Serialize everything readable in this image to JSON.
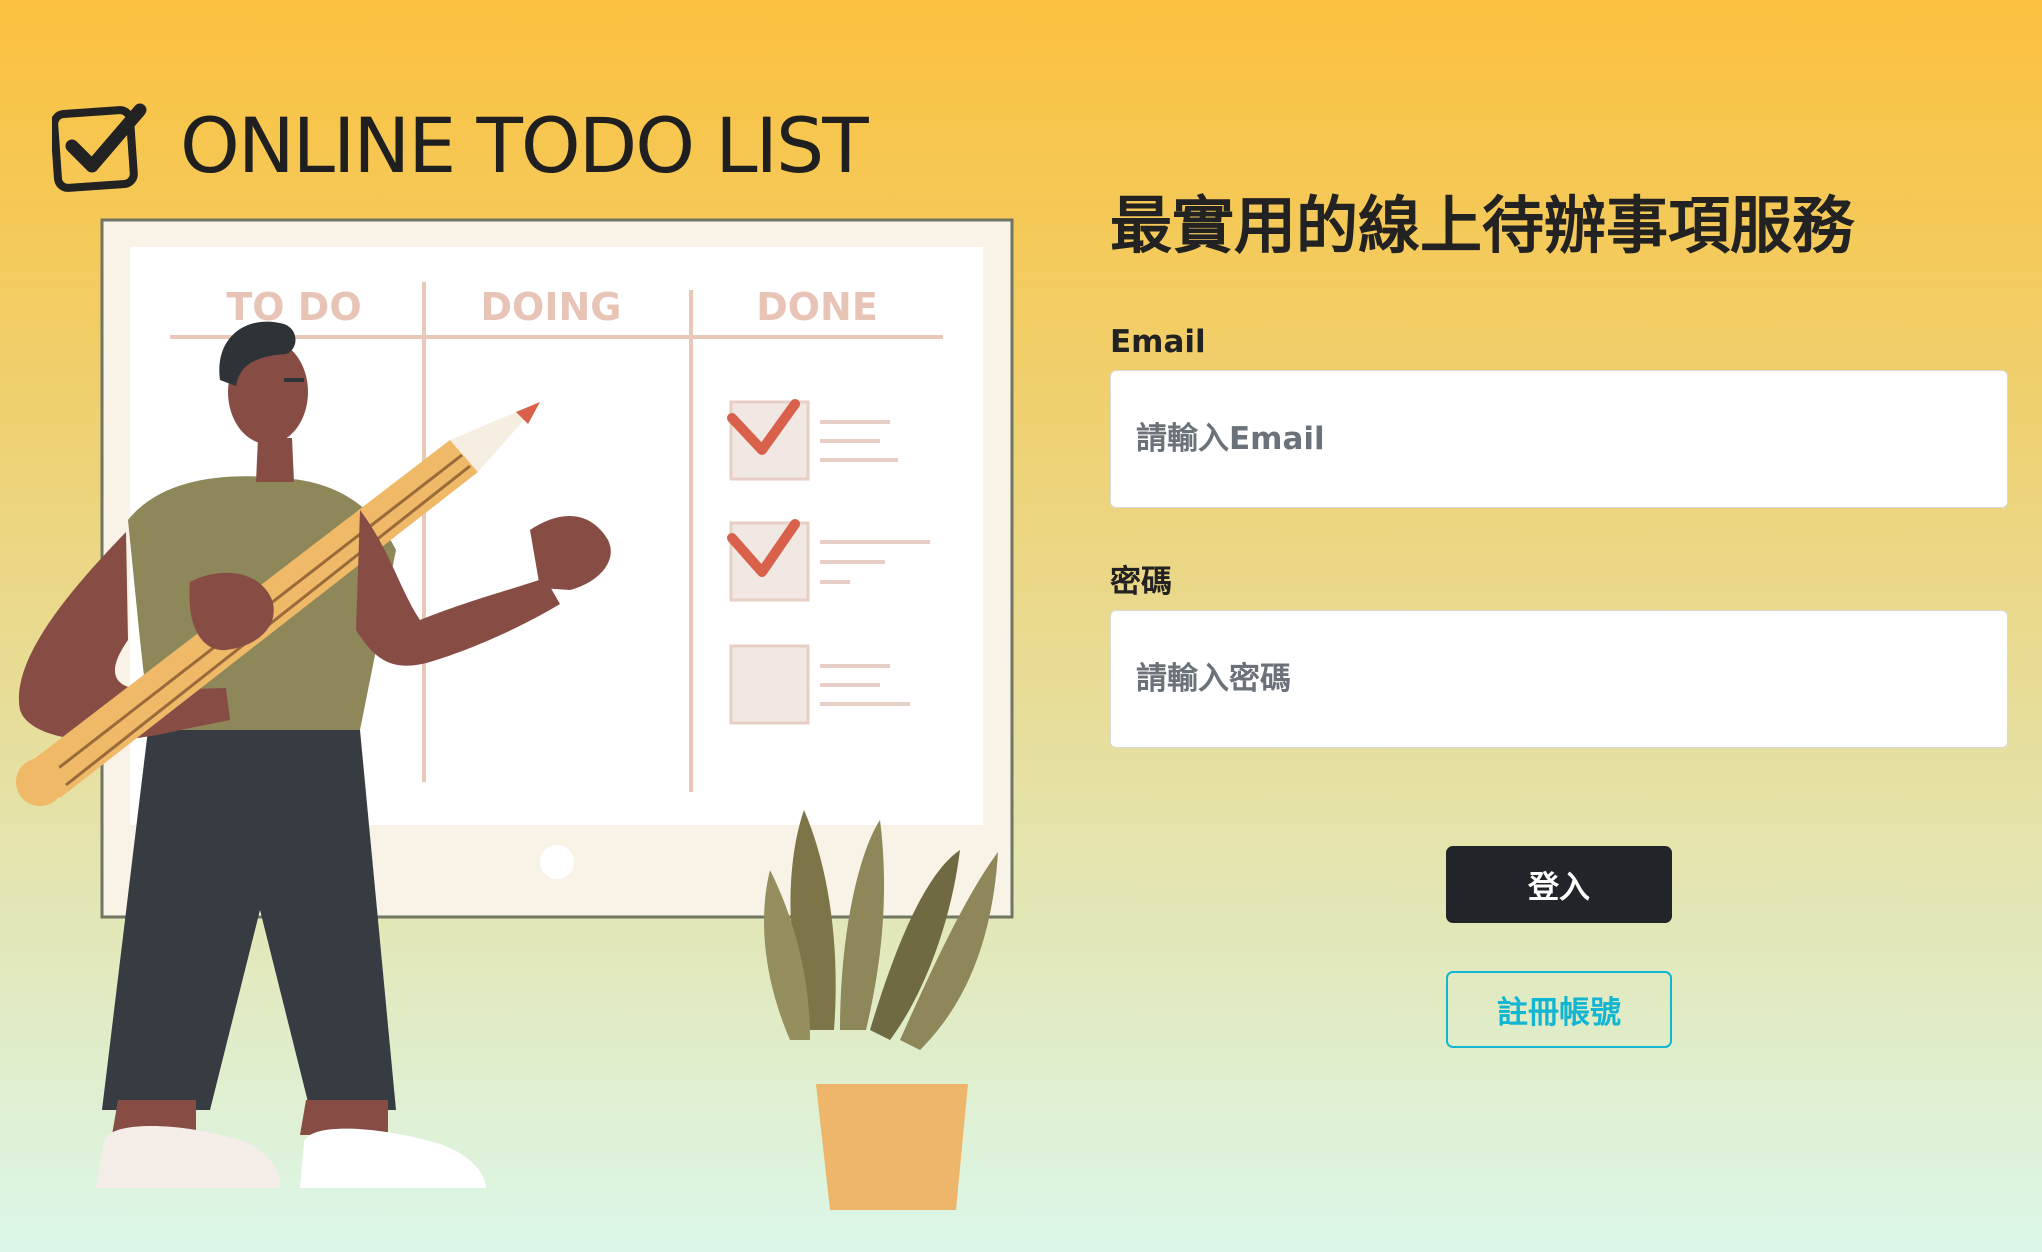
{
  "brand": {
    "title": "ONLINE TODO LIST",
    "logo_icon": "checkbox-check-icon"
  },
  "illustration": {
    "columns": [
      "TO DO",
      "DOING",
      "DONE"
    ]
  },
  "form": {
    "tagline": "最實用的線上待辦事項服務",
    "email": {
      "label": "Email",
      "placeholder": "請輸入Email",
      "value": ""
    },
    "password": {
      "label": "密碼",
      "placeholder": "請輸入密碼",
      "value": ""
    },
    "login_label": "登入",
    "register_label": "註冊帳號"
  },
  "colors": {
    "accent": "#12B5D2",
    "primary_button": "#212529",
    "check_mark": "#D9604A",
    "background_top": "#FBC13F",
    "background_bottom": "#DCF7E9"
  }
}
